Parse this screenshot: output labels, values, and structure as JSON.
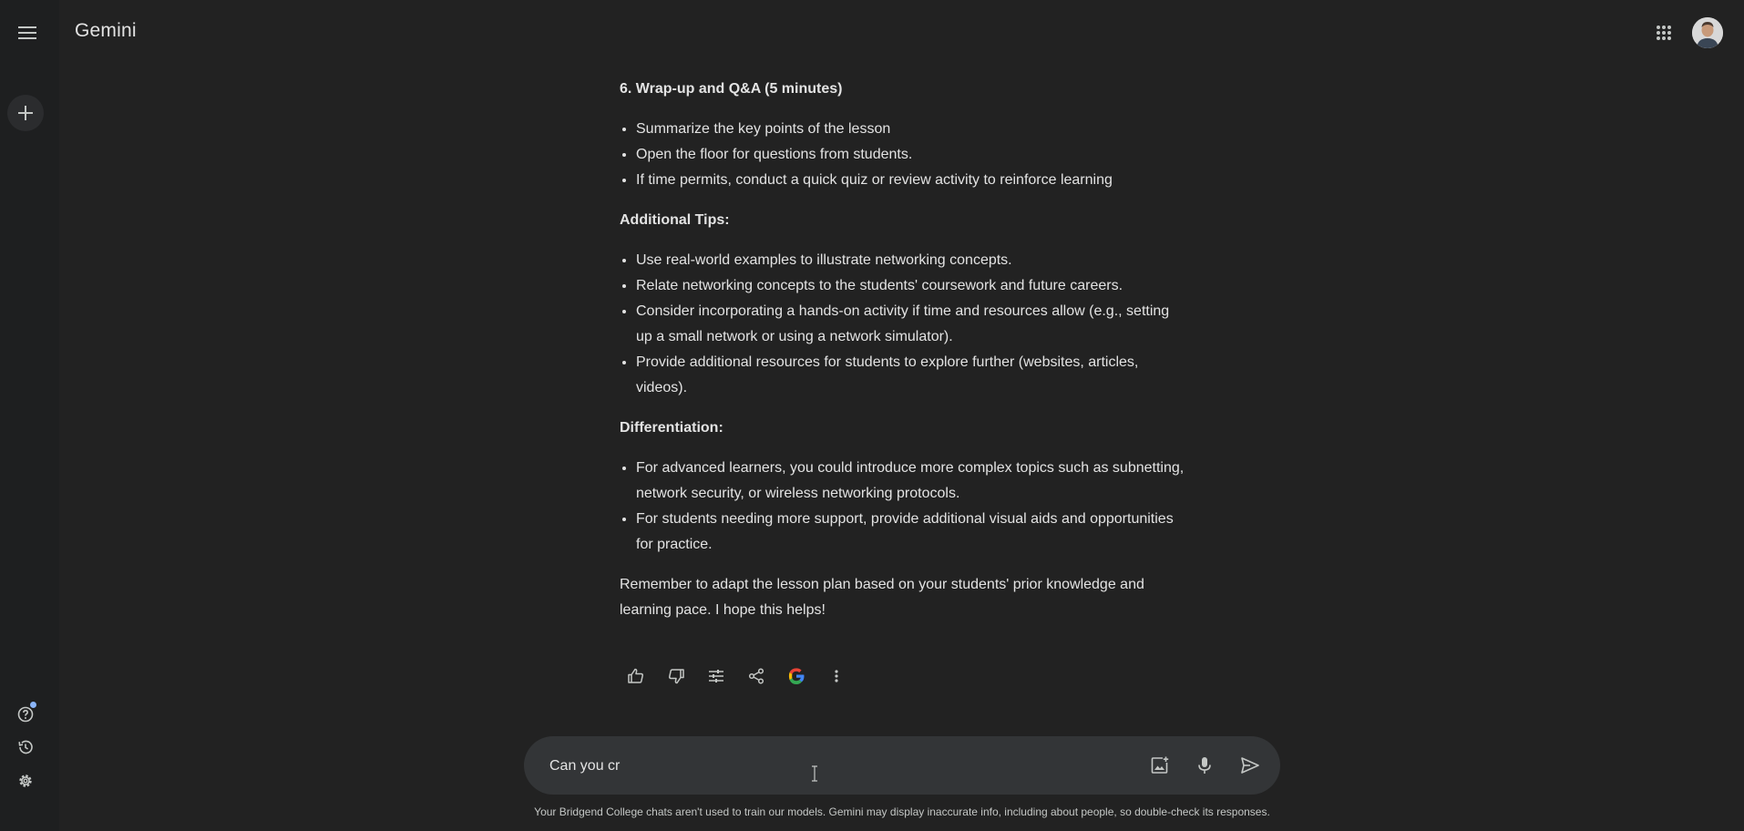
{
  "app": {
    "title": "Gemini"
  },
  "response": {
    "sections": [
      {
        "heading": "6. Wrap-up and Q&A (5 minutes)",
        "items": [
          "Summarize the key points of the lesson",
          "Open the floor for questions from students.",
          "If time permits, conduct a quick quiz or review activity to reinforce learning"
        ]
      },
      {
        "heading": "Additional Tips:",
        "items": [
          "Use real-world examples to illustrate networking concepts.",
          "Relate networking concepts to the students' coursework and future careers.",
          "Consider incorporating a hands-on activity if time and resources allow (e.g., setting up a small network or using a network simulator).",
          "Provide additional resources for students to explore further (websites, articles, videos)."
        ]
      },
      {
        "heading": "Differentiation:",
        "items": [
          "For advanced learners, you could introduce more complex topics such as subnetting, network security, or wireless networking protocols.",
          "For students needing more support, provide additional visual aids and opportunities for practice."
        ]
      }
    ],
    "closing": "Remember to adapt the lesson plan based on your students' prior knowledge and learning pace. I hope this helps!"
  },
  "actions": [
    "thumbs-up-icon",
    "thumbs-down-icon",
    "tune-icon",
    "share-icon",
    "google-icon",
    "more-vert-icon"
  ],
  "composer": {
    "value": "Can you cr"
  },
  "disclaimer": "Your Bridgend College chats aren't used to train our models. Gemini may display inaccurate info, including about people, so double-check its responses.",
  "colors": {
    "accent": "#8ab4f8",
    "background": "#222222",
    "sidebar": "#1e1f20",
    "composer": "#333537"
  }
}
